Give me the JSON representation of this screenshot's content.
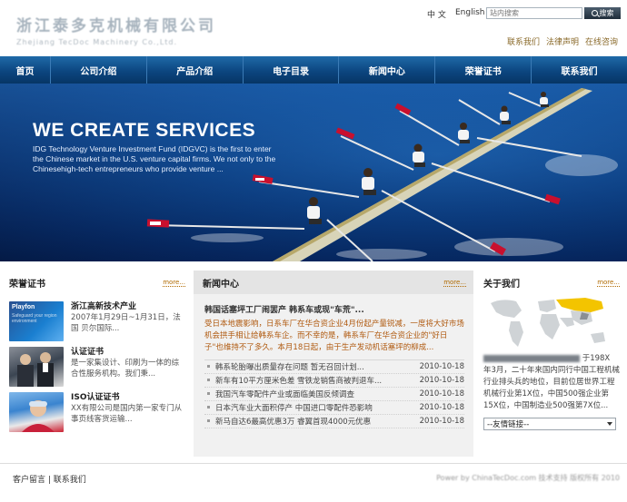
{
  "header": {
    "company_cn": "浙江泰多克机械有限公司",
    "company_en": "Zhejiang TecDoc Machinery Co.,Ltd.",
    "lang_cn": "中 文",
    "lang_en": "English",
    "search_placeholder": "站内搜索",
    "search_button": "搜索",
    "links": [
      "联系我们",
      "法律声明",
      "在线咨询"
    ]
  },
  "nav": [
    "首页",
    "公司介绍",
    "产品介绍",
    "电子目录",
    "新闻中心",
    "荣誉证书",
    "联系我们"
  ],
  "banner": {
    "title": "WE CREATE SERVICES",
    "text": "IDG Technology Venture Investment Fund (IDGVC) is the first to enter the Chinese market in the U.S. venture capital firms. We not only to the Chinesehigh-tech entrepreneurs who provide venture ..."
  },
  "certs": {
    "title": "荣誉证书",
    "more": "more...",
    "items": [
      {
        "img_title": "Playfon",
        "img_sub": "Safeguard your region environment",
        "title": "浙江高新技术产业",
        "desc": "2007年1月29日~1月31日，法国 贝尔国际..."
      },
      {
        "img_title": "",
        "img_sub": "",
        "title": "认证证书",
        "desc": "是一家集设计、印刷为一体的综合性服务机构。我们秉..."
      },
      {
        "img_title": "",
        "img_sub": "",
        "title": "ISO认证证书",
        "desc": "XX有限公司是国内第一家专门从事页线客货运输..."
      }
    ]
  },
  "news": {
    "title": "新闻中心",
    "more": "more...",
    "headline": "韩国话塞坪工厂闹罢产 韩系车或现\"车荒\"...",
    "summary": "受日本地震影响，日系车厂在华合资企业4月份起产量锐减，一度将大好市场机会拱手相让给韩系车企。而不幸的是，韩系车厂在华合资企业的\"好日子\"也维持不了多久。本月18日起，由于生产发动机话塞坪的柳成...",
    "items": [
      {
        "title": "韩系轮胎曝出质量存在问题 暂无召回计划...",
        "date": "2010-10-18"
      },
      {
        "title": "新车有10平方厘米色差 雪铁龙销售商被判退车...",
        "date": "2010-10-18"
      },
      {
        "title": "我国汽车零配件产业或面临美国反倾调查",
        "date": "2010-10-18"
      },
      {
        "title": "日本汽车业大面积停产 中国进口零配件恐影响",
        "date": "2010-10-18"
      },
      {
        "title": "新马自达6最高优惠3万 睿翼首现4000元优惠",
        "date": "2010-10-18"
      }
    ]
  },
  "about": {
    "title": "关于我们",
    "more": "more...",
    "text_end1": "于198X",
    "text_body": "年3月，二十年来国内同行中国工程机械行业排头兵的地位，目前位居世界工程机械行业第1X位，中国500强企业第15X位，中国制造业500强第7X位...",
    "select_label": "--友情链接--"
  },
  "footer": {
    "links": "客户留言 | 联系我们",
    "right": "Power by ChinaTecDoc.com 技术支持 版权所有 2010"
  },
  "colors": {
    "nav_bg": "#0c4680",
    "banner_bg": "#0b3f86",
    "link_orange": "#b06a00",
    "map_highlight": "#f3c400"
  }
}
